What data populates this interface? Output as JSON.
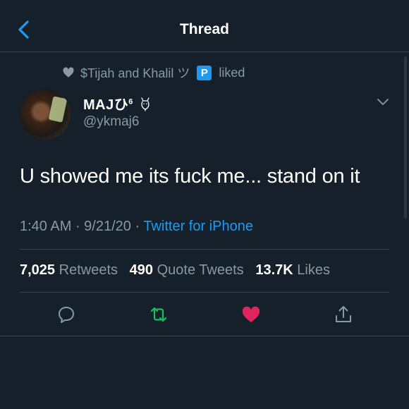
{
  "header": {
    "title": "Thread"
  },
  "social_context": {
    "names": "$Tijah and Khalil ツ",
    "badge": "P",
    "action": "liked"
  },
  "tweet": {
    "display_name": "MAJ",
    "name_glyph": "ひ",
    "name_sup": "6",
    "handle": "@ykmaj6",
    "text": "U showed me its fuck me... stand on it",
    "time": "1:40 AM",
    "sep1": " · ",
    "date": "9/21/20",
    "sep2": " · ",
    "source": "Twitter for iPhone"
  },
  "stats": {
    "retweets_count": "7,025",
    "retweets_label": "Retweets",
    "quotes_count": "490",
    "quotes_label": "Quote Tweets",
    "likes_count": "13.7K",
    "likes_label": "Likes"
  },
  "colors": {
    "background": "#15202b",
    "accent": "#1d9bf0",
    "retweet": "#17bf63",
    "like": "#e0245e",
    "muted": "#8899a6"
  },
  "icons": [
    "back-chevron-icon",
    "heart-icon",
    "owl-icon",
    "chevron-down-icon",
    "reply-icon",
    "retweet-icon",
    "like-icon",
    "share-icon"
  ]
}
